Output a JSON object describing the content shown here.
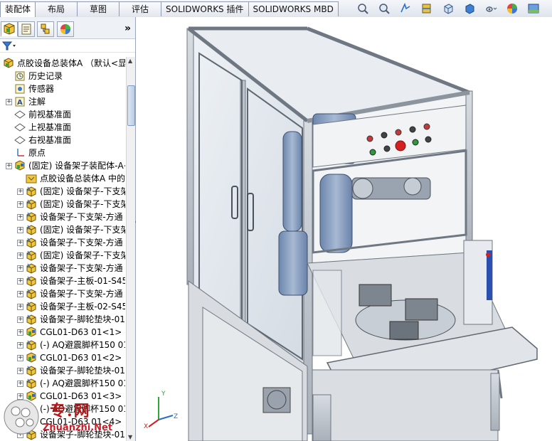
{
  "tabs": [
    {
      "label": "装配体",
      "active": true
    },
    {
      "label": "布局",
      "active": false
    },
    {
      "label": "草图",
      "active": false
    },
    {
      "label": "评估",
      "active": false
    },
    {
      "label": "SOLIDWORKS 插件",
      "active": false
    },
    {
      "label": "SOLIDWORKS MBD",
      "active": false
    }
  ],
  "view_toolbar_icons": [
    "zoom-to-fit-icon",
    "zoom-area-icon",
    "previous-view-icon",
    "section-view-icon",
    "view-orientation-icon",
    "display-style-icon",
    "hide-show-icon",
    "appearance-icon",
    "scene-icon"
  ],
  "manager_tabs": [
    "featuremanager-icon",
    "propertymanager-icon",
    "configurationmanager-icon",
    "displaymanager-icon"
  ],
  "collapse_label": "»",
  "filter_icon": "filter-icon",
  "tree": {
    "root": "点胶设备总装体A （默认<显示",
    "items": [
      {
        "label": "历史记录",
        "icon": "history-icon",
        "expander": false,
        "indent": 1
      },
      {
        "label": "传感器",
        "icon": "sensor-icon",
        "expander": false,
        "indent": 1
      },
      {
        "label": "注解",
        "icon": "annotation-icon",
        "expander": true,
        "indent": 1
      },
      {
        "label": "前视基准面",
        "icon": "plane-icon",
        "expander": false,
        "indent": 1
      },
      {
        "label": "上视基准面",
        "icon": "plane-icon",
        "expander": false,
        "indent": 1
      },
      {
        "label": "右视基准面",
        "icon": "plane-icon",
        "expander": false,
        "indent": 1
      },
      {
        "label": "原点",
        "icon": "origin-icon",
        "expander": false,
        "indent": 1
      },
      {
        "label": "(固定) 设备架子装配体-A<",
        "icon": "subassembly-icon",
        "expander": true,
        "indent": 1
      },
      {
        "label": "点胶设备总装体A 中的",
        "icon": "mate-folder-icon",
        "expander": false,
        "indent": 2
      },
      {
        "label": "(固定) 设备架子-下支架",
        "icon": "part-icon",
        "expander": true,
        "indent": 2
      },
      {
        "label": "(固定) 设备架子-下支架",
        "icon": "part-icon",
        "expander": true,
        "indent": 2
      },
      {
        "label": "设备架子-下支架-方通",
        "icon": "part-icon",
        "expander": true,
        "indent": 2
      },
      {
        "label": "(固定) 设备架子-下支架",
        "icon": "part-icon",
        "expander": true,
        "indent": 2
      },
      {
        "label": "设备架子-下支架-方通",
        "icon": "part-icon",
        "expander": true,
        "indent": 2
      },
      {
        "label": "(固定) 设备架子-下支架",
        "icon": "part-icon",
        "expander": true,
        "indent": 2
      },
      {
        "label": "设备架子-下支架-方通",
        "icon": "part-icon",
        "expander": true,
        "indent": 2
      },
      {
        "label": "设备架子-主板-01-S45",
        "icon": "part-icon",
        "expander": true,
        "indent": 2
      },
      {
        "label": "设备架子-下支架-方通",
        "icon": "part-icon",
        "expander": true,
        "indent": 2
      },
      {
        "label": "设备架子-主板-02-S45",
        "icon": "part-icon",
        "expander": true,
        "indent": 2
      },
      {
        "label": "设备架子-脚轮垫块-01",
        "icon": "part-icon",
        "expander": true,
        "indent": 2
      },
      {
        "label": "CGL01-D63 01<1> (",
        "icon": "subassembly-icon",
        "expander": true,
        "indent": 2
      },
      {
        "label": "(-) AQ避震脚杯150 01",
        "icon": "part-icon",
        "expander": true,
        "indent": 2
      },
      {
        "label": "CGL01-D63 01<2> (",
        "icon": "subassembly-icon",
        "expander": true,
        "indent": 2
      },
      {
        "label": "设备架子-脚轮垫块-01",
        "icon": "part-icon",
        "expander": true,
        "indent": 2
      },
      {
        "label": "(-) AQ避震脚杯150 01",
        "icon": "part-icon",
        "expander": true,
        "indent": 2
      },
      {
        "label": "CGL01-D63 01<3> (",
        "icon": "subassembly-icon",
        "expander": true,
        "indent": 2
      },
      {
        "label": "(-) AQ避震脚杯150 01",
        "icon": "part-icon",
        "expander": true,
        "indent": 2
      },
      {
        "label": "CGL01-D63 01<4> (",
        "icon": "subassembly-icon",
        "expander": true,
        "indent": 2
      },
      {
        "label": "设备架子-脚轮垫块-01",
        "icon": "part-icon",
        "expander": true,
        "indent": 2
      }
    ]
  },
  "triad": {
    "x": "X",
    "y": "Y",
    "z": "Z"
  },
  "watermark": {
    "text": "专.网",
    "url": "Zhuanzhi.Net"
  },
  "colors": {
    "accent": "#2b6fc4",
    "panel_border": "#9aa6b8",
    "frame": "#9aa3ad",
    "glass": "#dfe6ee",
    "robot": "#8fa3c2",
    "button_red": "#d42020",
    "watermark": "#c8202a"
  }
}
